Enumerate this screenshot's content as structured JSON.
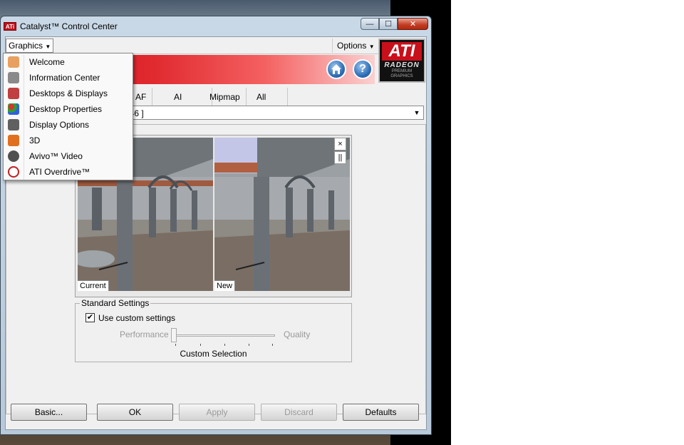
{
  "window": {
    "title": "Catalyst™ Control Center",
    "minimize_glyph": "—",
    "maximize_glyph": "☐",
    "close_glyph": "✕"
  },
  "menubar": {
    "graphics_label": "Graphics",
    "options_label": "Options"
  },
  "header": {
    "home_icon": "home-icon",
    "help_icon": "help-icon",
    "help_glyph": "?",
    "logo": {
      "brand": "ATI",
      "product": "RADEON",
      "tagline_1": "PREMIUM",
      "tagline_2": "GRAPHICS"
    }
  },
  "tabs": [
    {
      "label": "AF"
    },
    {
      "label": "AI"
    },
    {
      "label": "Mipmap"
    },
    {
      "label": "All"
    }
  ],
  "device_combo": {
    "visible_text": "246 ]"
  },
  "preview": {
    "current_label": "Current",
    "new_label": "New",
    "close_glyph": "×",
    "pause_glyph": "||"
  },
  "standard_settings": {
    "legend": "Standard Settings",
    "use_custom_label": "Use custom settings",
    "use_custom_checked": true,
    "slider_left_label": "Performance",
    "slider_right_label": "Quality",
    "slider_value_fraction": 0.0,
    "selection_label": "Custom Selection"
  },
  "buttons": {
    "basic": "Basic...",
    "ok": "OK",
    "apply": "Apply",
    "discard": "Discard",
    "defaults": "Defaults"
  },
  "graphics_menu": [
    {
      "label": "Welcome",
      "icon": "hand-icon",
      "color": "#e8a060"
    },
    {
      "label": "Information Center",
      "icon": "info-center-icon",
      "color": "#8a8a8a"
    },
    {
      "label": "Desktops & Displays",
      "icon": "displays-icon",
      "color": "#c04040"
    },
    {
      "label": "Desktop Properties",
      "icon": "color-dots-icon",
      "color": "#4080e0"
    },
    {
      "label": "Display Options",
      "icon": "display-options-icon",
      "color": "#606060"
    },
    {
      "label": "3D",
      "icon": "3d-icon",
      "color": "#e07020"
    },
    {
      "label": "Avivo™ Video",
      "icon": "video-reel-icon",
      "color": "#505050"
    },
    {
      "label": "ATI Overdrive™",
      "icon": "gauge-icon",
      "color": "#c02020"
    }
  ],
  "colors": {
    "header_red": "#c81018",
    "ati_red": "#c8101a",
    "disabled_text": "#9a9a9a"
  }
}
